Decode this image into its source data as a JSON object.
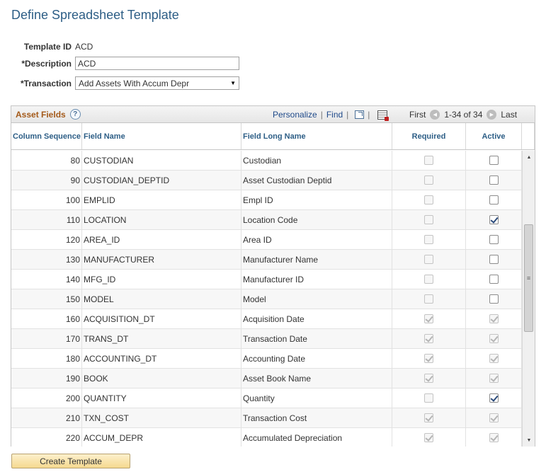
{
  "page": {
    "title": "Define Spreadsheet Template"
  },
  "form": {
    "template_id_label": "Template ID",
    "template_id_value": "ACD",
    "description_label": "*Description",
    "description_value": "ACD",
    "transaction_label": "*Transaction",
    "transaction_value": "Add Assets With Accum Depr"
  },
  "grid": {
    "title": "Asset Fields",
    "help_icon": "?",
    "personalize": "Personalize",
    "find": "Find",
    "first": "First",
    "range": "1-34 of 34",
    "last": "Last",
    "columns": [
      "Column Sequence",
      "Field Name",
      "Field Long Name",
      "Required",
      "Active"
    ],
    "rows": [
      {
        "seq": "80",
        "field": "CUSTODIAN",
        "long": "Custodian",
        "required": false,
        "req_enabled": false,
        "active": false,
        "act_enabled": true
      },
      {
        "seq": "90",
        "field": "CUSTODIAN_DEPTID",
        "long": "Asset Custodian Deptid",
        "required": false,
        "req_enabled": false,
        "active": false,
        "act_enabled": true
      },
      {
        "seq": "100",
        "field": "EMPLID",
        "long": "Empl ID",
        "required": false,
        "req_enabled": false,
        "active": false,
        "act_enabled": true
      },
      {
        "seq": "110",
        "field": "LOCATION",
        "long": "Location Code",
        "required": false,
        "req_enabled": false,
        "active": true,
        "act_enabled": true
      },
      {
        "seq": "120",
        "field": "AREA_ID",
        "long": "Area ID",
        "required": false,
        "req_enabled": false,
        "active": false,
        "act_enabled": true
      },
      {
        "seq": "130",
        "field": "MANUFACTURER",
        "long": "Manufacturer Name",
        "required": false,
        "req_enabled": false,
        "active": false,
        "act_enabled": true
      },
      {
        "seq": "140",
        "field": "MFG_ID",
        "long": "Manufacturer ID",
        "required": false,
        "req_enabled": false,
        "active": false,
        "act_enabled": true
      },
      {
        "seq": "150",
        "field": "MODEL",
        "long": "Model",
        "required": false,
        "req_enabled": false,
        "active": false,
        "act_enabled": true
      },
      {
        "seq": "160",
        "field": "ACQUISITION_DT",
        "long": "Acquisition Date",
        "required": true,
        "req_enabled": false,
        "active": true,
        "act_enabled": false
      },
      {
        "seq": "170",
        "field": "TRANS_DT",
        "long": "Transaction Date",
        "required": true,
        "req_enabled": false,
        "active": true,
        "act_enabled": false
      },
      {
        "seq": "180",
        "field": "ACCOUNTING_DT",
        "long": "Accounting Date",
        "required": true,
        "req_enabled": false,
        "active": true,
        "act_enabled": false
      },
      {
        "seq": "190",
        "field": "BOOK",
        "long": "Asset Book Name",
        "required": true,
        "req_enabled": false,
        "active": true,
        "act_enabled": false
      },
      {
        "seq": "200",
        "field": "QUANTITY",
        "long": "Quantity",
        "required": false,
        "req_enabled": false,
        "active": true,
        "act_enabled": true
      },
      {
        "seq": "210",
        "field": "TXN_COST",
        "long": "Transaction Cost",
        "required": true,
        "req_enabled": false,
        "active": true,
        "act_enabled": false
      },
      {
        "seq": "220",
        "field": "ACCUM_DEPR",
        "long": "Accumulated Depreciation",
        "required": true,
        "req_enabled": false,
        "active": true,
        "act_enabled": false
      }
    ]
  },
  "footer": {
    "create_button": "Create Template"
  },
  "icons": {
    "select_arrow": "▼",
    "prev": "◀",
    "next": "▶",
    "scroll_up": "▲",
    "scroll_down": "▼",
    "scroll_grip": "≡"
  }
}
